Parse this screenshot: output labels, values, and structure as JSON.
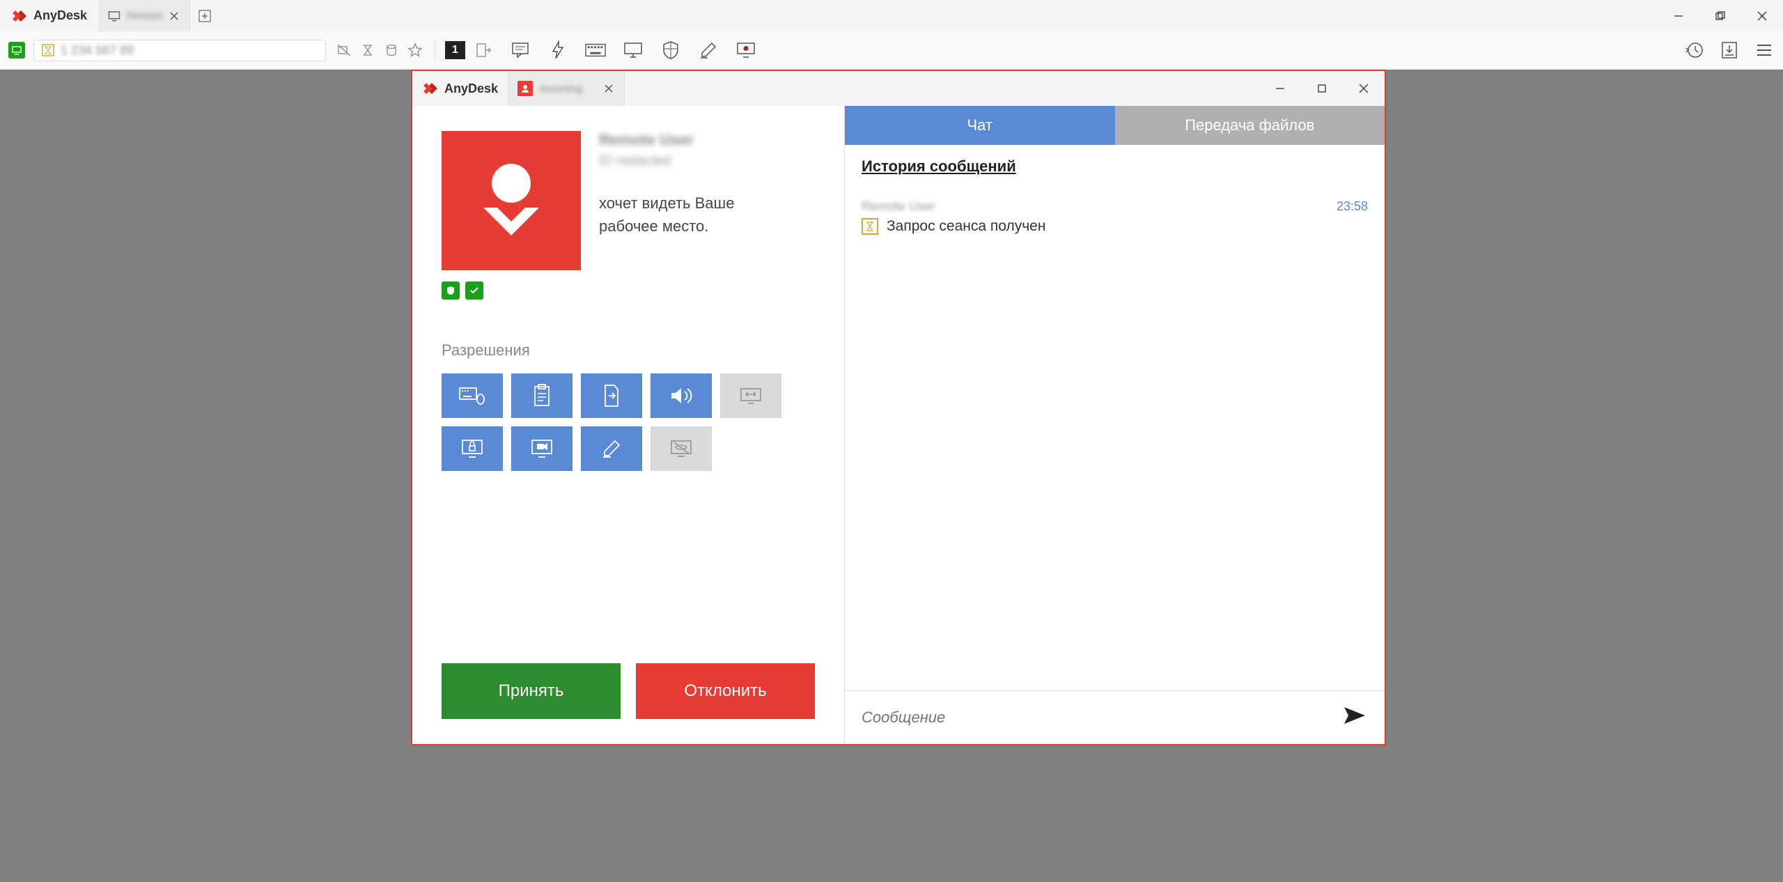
{
  "app": {
    "name": "AnyDesk"
  },
  "main_tab": {
    "label": "Session"
  },
  "address": {
    "text": "1 234 567 89"
  },
  "toolbar": {
    "badge": "1"
  },
  "dialog": {
    "title": "AnyDesk",
    "tab_label": "Incoming",
    "requester": {
      "name": "Remote User",
      "id": "ID redacted",
      "request_text_l1": "хочет видеть Ваше",
      "request_text_l2": "рабочее место."
    },
    "permissions_label": "Разрешения",
    "accept": "Принять",
    "reject": "Отклонить"
  },
  "chat": {
    "tab_chat": "Чат",
    "tab_files": "Передача файлов",
    "history_title": "История сообщений",
    "entry": {
      "name": "Remote User",
      "time": "23:58",
      "text": "Запрос сеанса получен"
    },
    "input_placeholder": "Сообщение"
  }
}
